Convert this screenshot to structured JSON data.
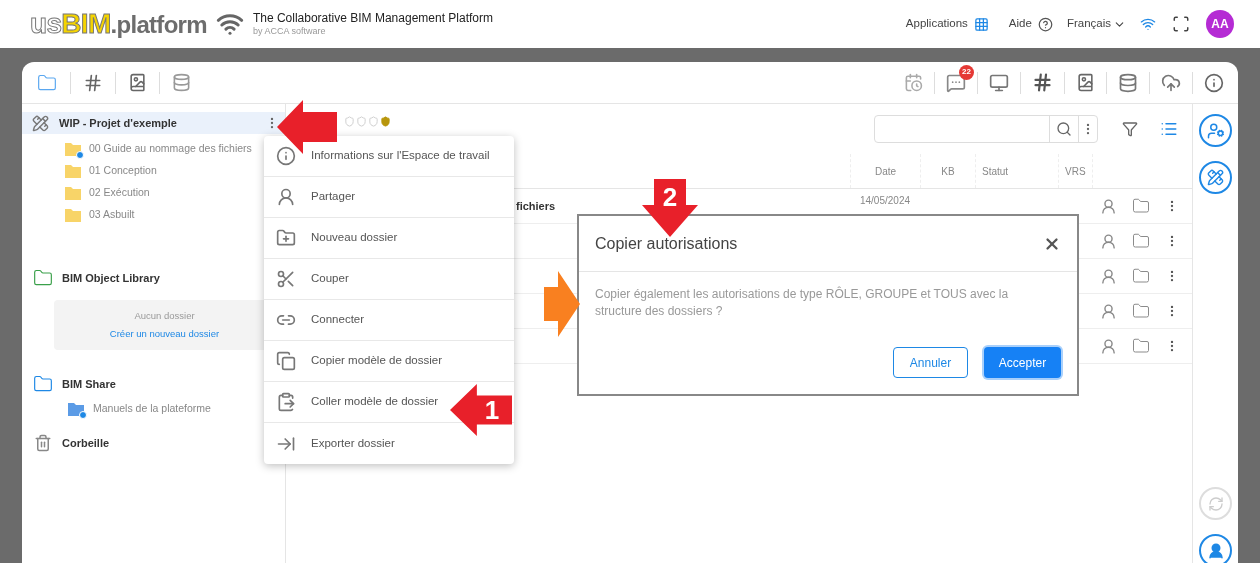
{
  "header": {
    "logo": {
      "outline": "us",
      "highlight": "BIM",
      "rest": ".platform"
    },
    "tagline": "The Collaborative BIM Management Platform",
    "byline": "by ACCA software",
    "nav": {
      "applications": "Applications",
      "help": "Aide",
      "language": "Français",
      "avatar": "AA"
    }
  },
  "toolbar": {
    "messages_badge": "22"
  },
  "sidebar": {
    "workspace": {
      "name": "WIP - Projet d'exemple",
      "selected": true,
      "children": [
        {
          "name": "00 Guide au nommage des fichiers",
          "shared": true
        },
        {
          "name": "01 Conception",
          "shared": false
        },
        {
          "name": "02 Exécution",
          "shared": false
        },
        {
          "name": "03 Asbuilt",
          "shared": false
        }
      ]
    },
    "library": {
      "name": "BIM Object Library",
      "empty_text": "Aucun dossier",
      "create_link": "Créer un nouveau dossier"
    },
    "share": {
      "name": "BIM Share",
      "children": [
        {
          "name": "Manuels de la plateforme",
          "shared": true
        }
      ]
    },
    "trash": {
      "name": "Corbeille"
    }
  },
  "table": {
    "columns": [
      "Date",
      "KB",
      "Statut",
      "VRS"
    ],
    "rows": [
      {
        "kind": "folder",
        "name": "fichiers",
        "date": "14/05/2024"
      },
      {
        "kind": "folder"
      },
      {
        "kind": "folder"
      },
      {
        "kind": "folder"
      },
      {
        "kind": "folder"
      }
    ]
  },
  "context_menu": [
    {
      "kind": "info",
      "label": "Informations sur l'Espace de travail"
    },
    {
      "kind": "share",
      "label": "Partager"
    },
    {
      "kind": "new-folder",
      "label": "Nouveau dossier"
    },
    {
      "kind": "cut",
      "label": "Couper"
    },
    {
      "kind": "link",
      "label": "Connecter"
    },
    {
      "kind": "copy-template",
      "label": "Copier modèle de dossier"
    },
    {
      "kind": "paste-template",
      "label": "Coller modèle de dossier"
    },
    {
      "kind": "export",
      "label": "Exporter dossier"
    }
  ],
  "dialog": {
    "title": "Copier autorisations",
    "message": "Copier également les autorisations de type RÔLE, GROUPE et TOUS avec la structure des dossiers ?",
    "cancel": "Annuler",
    "accept": "Accepter"
  },
  "annotations": [
    {
      "kind": "left",
      "color": "#e8202a"
    },
    {
      "kind": "left",
      "color": "#e8202a",
      "label": "1"
    },
    {
      "kind": "down",
      "color": "#e8202a",
      "label": "2"
    },
    {
      "kind": "right",
      "color": "#f98020"
    }
  ]
}
